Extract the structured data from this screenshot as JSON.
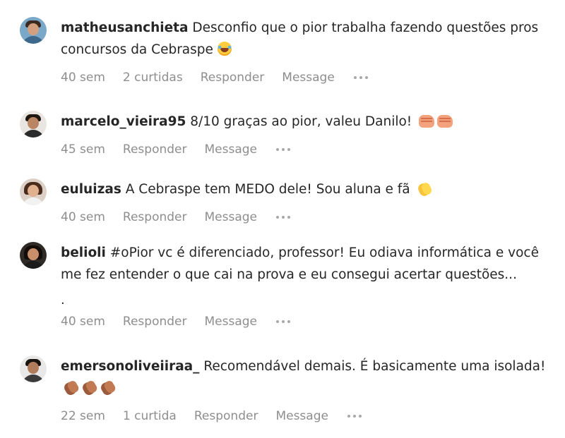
{
  "comments": [
    {
      "username": "matheusanchieta",
      "text": "Desconfio que o pior trabalha fazendo questões pros concursos da Cebraspe",
      "emoji": "face-with-tears-of-joy-emoji",
      "time": "40 sem",
      "likes": "2 curtidas",
      "reply": "Responder",
      "message": "Message"
    },
    {
      "username": "marcelo_vieira95",
      "text": "8/10 graças ao pior, valeu Danilo!",
      "emoji": "fist-bump-emoji",
      "time": "45 sem",
      "reply": "Responder",
      "message": "Message"
    },
    {
      "username": "euluizas",
      "text": "A Cebraspe tem MEDO dele! Sou aluna e fã",
      "emoji": "clapping-hands-emoji",
      "time": "40 sem",
      "reply": "Responder",
      "message": "Message"
    },
    {
      "username": "belioli",
      "text": "#oPior vc é diferenciado, professor! Eu odiava informática e você me fez entender o que cai na prova e eu consegui acertar questões...",
      "extra": ".",
      "time": "40 sem",
      "reply": "Responder",
      "message": "Message"
    },
    {
      "username": "emersonoliveiiraa_",
      "text": "Recomendável demais. É basicamente uma isolada!",
      "emoji": "clapping-hands-dark-emoji",
      "time": "22 sem",
      "likes": "1 curtida",
      "reply": "Responder",
      "message": "Message"
    }
  ],
  "colors": {
    "text": "#262626",
    "meta": "#8e8e8e"
  }
}
